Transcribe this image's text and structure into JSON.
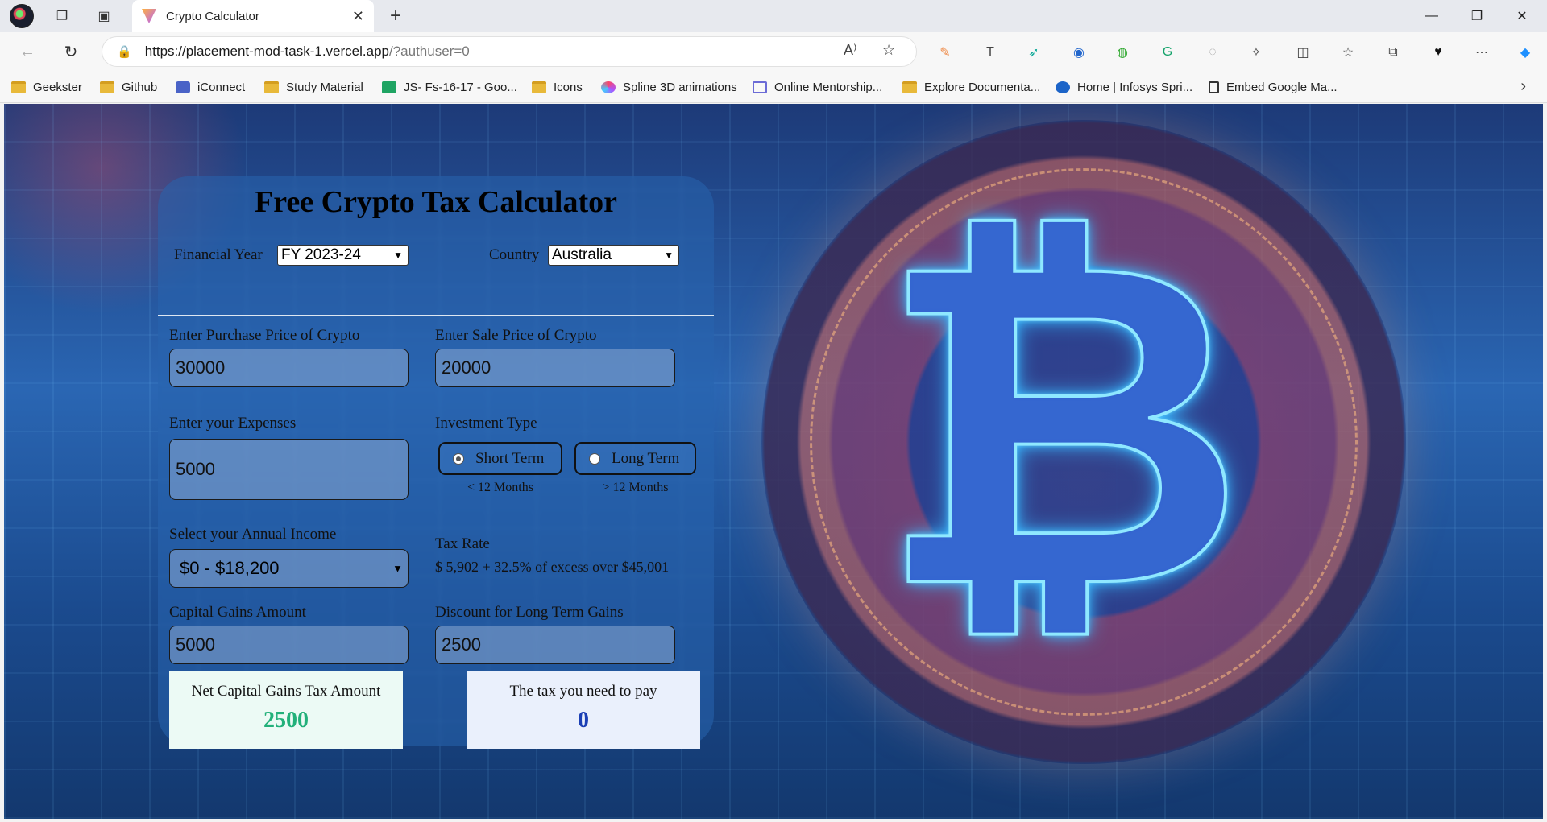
{
  "browser": {
    "tab_title": "Crypto Calculator",
    "url_host": "https://placement-mod-task-1.vercel.app",
    "url_rest": "/?authuser=0",
    "bookmarks": [
      {
        "label": "Geekster",
        "icon": "folder-icon"
      },
      {
        "label": "Github",
        "icon": "folder-icon"
      },
      {
        "label": "iConnect",
        "icon": "briefcase-icon"
      },
      {
        "label": "Study Material",
        "icon": "folder-icon"
      },
      {
        "label": "JS- Fs-16-17 - Goo...",
        "icon": "sheets-icon"
      },
      {
        "label": "Icons",
        "icon": "folder-icon"
      },
      {
        "label": "Spline 3D animations",
        "icon": "spline-icon"
      },
      {
        "label": "Online Mentorship...",
        "icon": "calendar-icon"
      },
      {
        "label": "Explore Documenta...",
        "icon": "folder-icon"
      },
      {
        "label": "Home | Infosys Spri...",
        "icon": "infosys-icon"
      },
      {
        "label": "Embed Google Ma...",
        "icon": "document-icon"
      }
    ]
  },
  "calculator": {
    "title": "Free Crypto Tax Calculator",
    "financial_year_label": "Financial Year",
    "financial_year_value": "FY 2023-24",
    "country_label": "Country",
    "country_value": "Australia",
    "purchase_label": "Enter Purchase Price of Crypto",
    "purchase_value": "30000",
    "sale_label": "Enter Sale Price of Crypto",
    "sale_value": "20000",
    "expenses_label": "Enter your Expenses",
    "expenses_value": "5000",
    "investment_type_label": "Investment Type",
    "short_term_label": "Short Term",
    "short_term_sub": "< 12 Months",
    "long_term_label": "Long Term",
    "long_term_sub": "> 12 Months",
    "selected_investment_type": "Short Term",
    "income_label": "Select your Annual Income",
    "income_value": "$0 - $18,200",
    "tax_rate_label": "Tax Rate",
    "tax_rate_value": "$ 5,902 + 32.5% of excess over $45,001",
    "capital_gains_label": "Capital Gains Amount",
    "capital_gains_value": "5000",
    "discount_label": "Discount for Long Term Gains",
    "discount_value": "2500",
    "net_tax_label": "Net Capital Gains Tax Amount",
    "net_tax_value": "2500",
    "tax_to_pay_label": "The tax you need to pay",
    "tax_to_pay_value": "0"
  },
  "colors": {
    "net_tax_value": "#22b07a",
    "tax_to_pay_value": "#1b3fb5",
    "net_tax_box_bg": "#ecfaf5",
    "tax_to_pay_box_bg": "#eaf0fc"
  }
}
